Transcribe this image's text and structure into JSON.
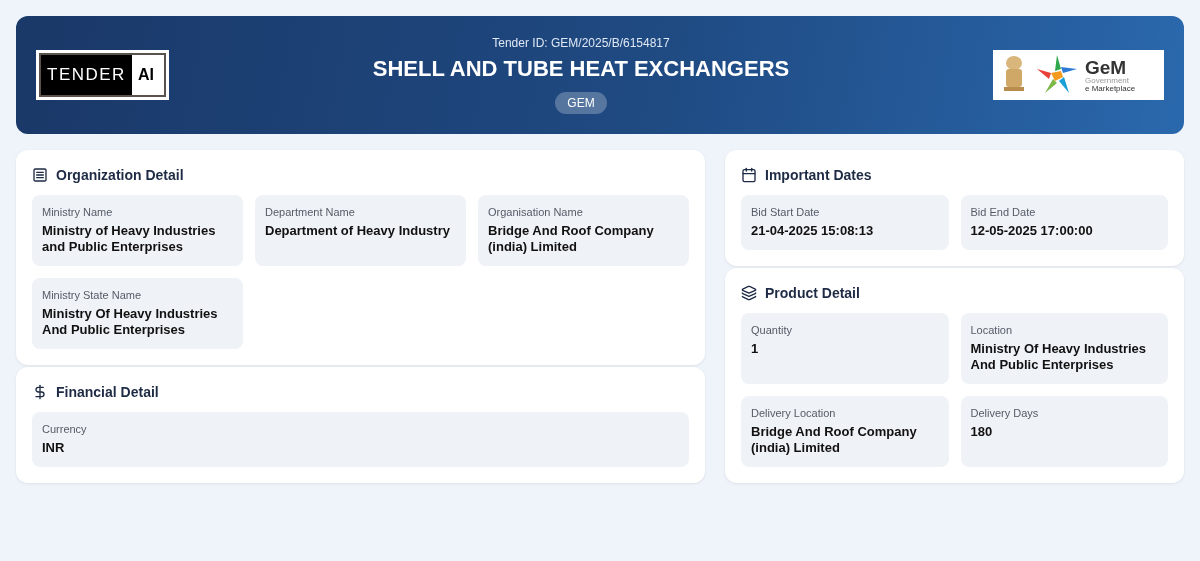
{
  "header": {
    "logo": {
      "left": "TENDER",
      "right": "AI"
    },
    "tender_id": "Tender ID: GEM/2025/B/6154817",
    "title": "SHELL AND TUBE HEAT EXCHANGERS",
    "badge": "GEM",
    "partner_logo": {
      "name": "GeM",
      "line1": "Government",
      "line2": "e Marketplace"
    }
  },
  "columns": [
    [
      {
        "title": "Organization Detail",
        "kind": "organization",
        "fields": [
          {
            "label": "Ministry Name",
            "value": "Ministry of Heavy Industries and Public Enterprises"
          },
          {
            "label": "Department Name",
            "value": "Department of Heavy Industry"
          },
          {
            "label": "Organisation Name",
            "value": "Bridge And Roof Company (india) Limited"
          },
          {
            "label": "Ministry State Name",
            "value": "Ministry Of Heavy Industries And Public Enterprises"
          }
        ]
      },
      {
        "title": "Financial Detail",
        "kind": "financial",
        "fields": [
          {
            "label": "Currency",
            "value": "INR"
          }
        ]
      }
    ],
    [
      {
        "title": "Important Dates",
        "kind": "dates",
        "fields": [
          {
            "label": "Bid Start Date",
            "value": "21-04-2025 15:08:13"
          },
          {
            "label": "Bid End Date",
            "value": "12-05-2025 17:00:00"
          }
        ]
      },
      {
        "title": "Product Detail",
        "kind": "product",
        "fields": [
          {
            "label": "Quantity",
            "value": "1"
          },
          {
            "label": "Location",
            "value": "Ministry Of Heavy Industries And Public Enterprises"
          },
          {
            "label": "Delivery Location",
            "value": "Bridge And Roof Company (india) Limited"
          },
          {
            "label": "Delivery Days",
            "value": "180"
          }
        ]
      }
    ]
  ]
}
